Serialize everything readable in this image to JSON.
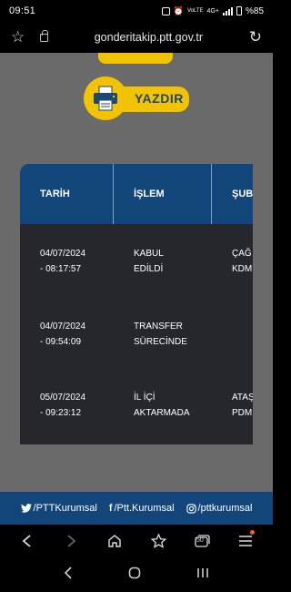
{
  "status_bar": {
    "time": "09:51",
    "battery": "%85",
    "network": "4G+",
    "volte": "VoLTE"
  },
  "browser": {
    "url": "gonderitakip.ptt.gov.tr",
    "tab_count": "50"
  },
  "page": {
    "print_button_label": "YAZDIR",
    "table": {
      "headers": [
        "TARİH",
        "İŞLEM",
        "ŞUBE"
      ],
      "rows": [
        {
          "date_line1": "04/07/2024",
          "date_line2": "- 08:17:57",
          "action_line1": "KABUL",
          "action_line2": "EDİLDİ",
          "branch_line1": "ÇAĞ",
          "branch_line2": "KDM"
        },
        {
          "date_line1": "04/07/2024",
          "date_line2": "- 09:54:09",
          "action_line1": "TRANSFER",
          "action_line2": "SÜRECİNDE",
          "branch_line1": "",
          "branch_line2": ""
        },
        {
          "date_line1": "05/07/2024",
          "date_line2": "- 09:23:12",
          "action_line1": "İL İÇİ",
          "action_line2": "AKTARMADA",
          "branch_line1": "ATAŞ",
          "branch_line2": "PDM"
        }
      ]
    }
  },
  "footer": {
    "twitter": "/PTTKurumsal",
    "facebook": "/Ptt.Kurumsal",
    "instagram": "/pttkurumsal"
  },
  "colors": {
    "ptt_blue": "#12457a",
    "ptt_yellow": "#f2c300",
    "table_body": "#25272c",
    "overlay_gray": "#6a6a6a",
    "notification_dot": "#ff5a1f"
  }
}
